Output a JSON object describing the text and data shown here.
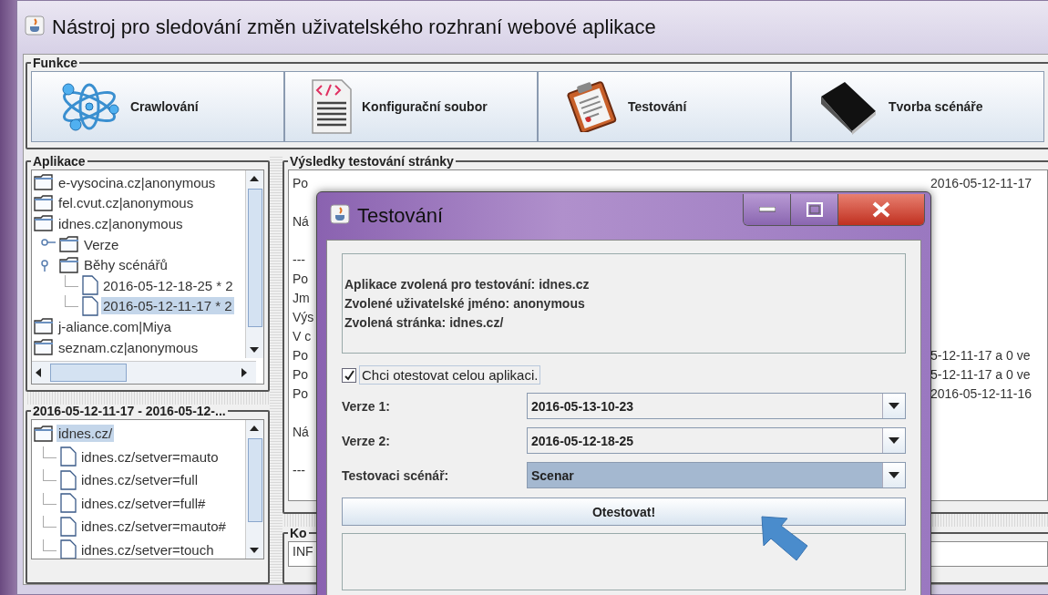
{
  "window": {
    "title": "Nástroj pro sledování změn uživatelského rozhraní webové aplikace"
  },
  "functions": {
    "title": "Funkce",
    "buttons": [
      {
        "label": "Crawlování",
        "kind": "atom"
      },
      {
        "label": "Konfigurační soubor",
        "kind": "document"
      },
      {
        "label": "Testování",
        "kind": "clipboard"
      },
      {
        "label": "Tvorba scénáře",
        "kind": "book"
      }
    ]
  },
  "apps": {
    "title": "Aplikace",
    "tree": [
      {
        "label": "e-vysocina.cz|anonymous",
        "kind": "folder",
        "selected": false
      },
      {
        "label": "fel.cvut.cz|anonymous",
        "kind": "folder",
        "selected": false
      },
      {
        "label": "idnes.cz|anonymous",
        "kind": "folder",
        "selected": false,
        "children": [
          {
            "label": "Verze",
            "kind": "folder",
            "selected": false,
            "expanded": false
          },
          {
            "label": "Běhy scénářů",
            "kind": "folder",
            "selected": false,
            "expanded": true,
            "children": [
              {
                "label": "2016-05-12-18-25 * 2",
                "kind": "file",
                "selected": false
              },
              {
                "label": "2016-05-12-11-17 * 2",
                "kind": "file",
                "selected": true
              }
            ]
          }
        ]
      },
      {
        "label": "j-aliance.com|Miya",
        "kind": "folder",
        "selected": false
      },
      {
        "label": "seznam.cz|anonymous",
        "kind": "folder",
        "selected": false
      }
    ]
  },
  "run": {
    "title": "2016-05-12-11-17 - 2016-05-12-...",
    "tree": [
      {
        "label": "idnes.cz/",
        "kind": "folder",
        "selected": true,
        "children": [
          {
            "label": "idnes.cz/setver=mauto",
            "kind": "file",
            "selected": false
          },
          {
            "label": "idnes.cz/setver=full",
            "kind": "file",
            "selected": false
          },
          {
            "label": "idnes.cz/setver=full#",
            "kind": "file",
            "selected": false
          },
          {
            "label": "idnes.cz/setver=mauto#",
            "kind": "file",
            "selected": false
          },
          {
            "label": "idnes.cz/setver=touch",
            "kind": "file",
            "selected": false
          }
        ]
      }
    ]
  },
  "results": {
    "title": "Výsledky testování stránky",
    "lines": [
      {
        "kind": "text",
        "left": "Po",
        "right": "2016-05-12-11-17"
      },
      {
        "kind": "blank"
      },
      {
        "kind": "text",
        "left": "Ná"
      },
      {
        "kind": "blank"
      },
      {
        "kind": "text",
        "left": "---"
      },
      {
        "kind": "text",
        "left": "Po"
      },
      {
        "kind": "text",
        "left": "Jm"
      },
      {
        "kind": "text",
        "left": "Výs"
      },
      {
        "kind": "text",
        "left": "V c"
      },
      {
        "kind": "text",
        "left": "Po",
        "right": "5-12-11-17 a 0 ve"
      },
      {
        "kind": "text",
        "left": "Po",
        "right": "5-12-11-17 a 0 ve"
      },
      {
        "kind": "text",
        "left": "Po",
        "right": "2016-05-12-11-16"
      },
      {
        "kind": "blank"
      },
      {
        "kind": "text",
        "left": "Ná"
      },
      {
        "kind": "blank"
      },
      {
        "kind": "text",
        "left": "---"
      }
    ]
  },
  "console": {
    "title": "Ko",
    "value": "INF"
  },
  "dialog": {
    "title": "Testování",
    "info": [
      "Aplikace zvolená pro testování: idnes.cz",
      "Zvolené uživatelské jméno: anonymous",
      "Zvolená stránka: idnes.cz/"
    ],
    "checkbox": {
      "label": "Chci otestovat celou aplikaci.",
      "checked": true
    },
    "combos": [
      {
        "label": "Verze 1:",
        "value": "2016-05-13-10-23",
        "selected": false
      },
      {
        "label": "Verze 2:",
        "value": "2016-05-12-18-25",
        "selected": false
      },
      {
        "label": "Testovaci scénář:",
        "value": "Scenar",
        "selected": true
      }
    ],
    "button": "Otestovat!"
  }
}
